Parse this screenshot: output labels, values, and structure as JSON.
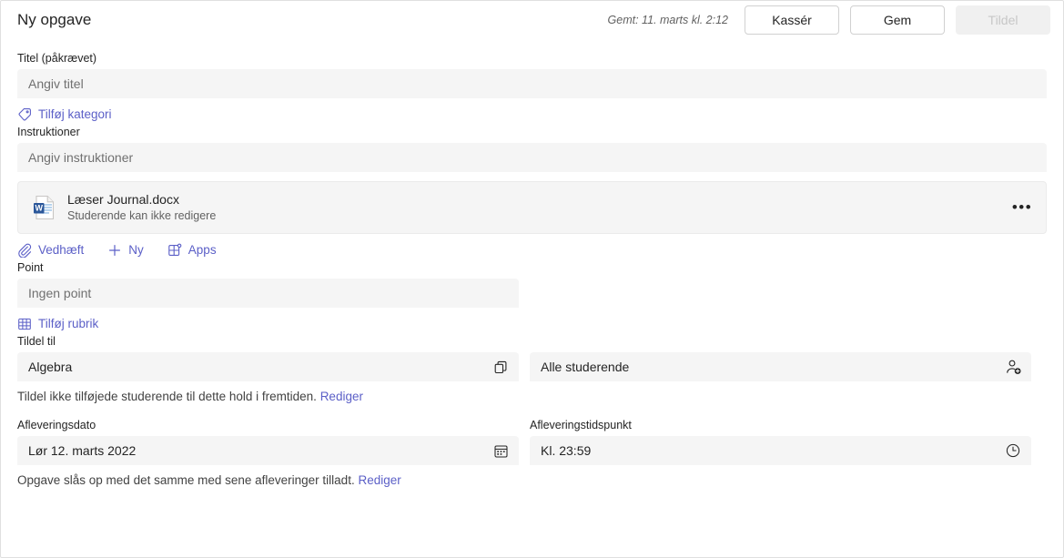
{
  "header": {
    "title": "Ny opgave",
    "saved_text": "Gemt: 11. marts kl. 2:12",
    "discard_label": "Kassér",
    "save_label": "Gem",
    "assign_label": "Tildel"
  },
  "title_field": {
    "label": "Titel (påkrævet)",
    "placeholder": "Angiv titel",
    "value": ""
  },
  "category_link": {
    "label": "Tilføj kategori",
    "icon": "tag-icon"
  },
  "instructions_field": {
    "label": "Instruktioner",
    "placeholder": "Angiv instruktioner",
    "value": ""
  },
  "attachment": {
    "icon": "word-doc-icon",
    "name": "Læser Journal.docx",
    "subtitle": "Studerende kan ikke redigere",
    "more_label": "•••"
  },
  "attach_actions": [
    {
      "label": "Vedhæft",
      "icon": "paperclip-icon"
    },
    {
      "label": "Ny",
      "icon": "plus-icon"
    },
    {
      "label": "Apps",
      "icon": "apps-grid-icon"
    }
  ],
  "points_field": {
    "label": "Point",
    "placeholder": "Ingen point",
    "value": ""
  },
  "rubric_link": {
    "label": "Tilføj rubrik",
    "icon": "grid-table-icon"
  },
  "assign_to": {
    "label": "Tildel til",
    "class_value": "Algebra",
    "class_icon": "copy-stack-icon",
    "students_value": "Alle studerende",
    "students_icon": "person-add-icon",
    "helper_text": "Tildel ikke tilføjede studerende til dette hold i fremtiden.",
    "helper_link": "Rediger"
  },
  "due": {
    "date_label": "Afleveringsdato",
    "date_value": "Lør 12. marts 2022",
    "date_icon": "calendar-icon",
    "time_label": "Afleveringstidspunkt",
    "time_value": "Kl. 23:59",
    "time_icon": "clock-icon",
    "helper_text": "Opgave slås op med det samme med sene afleveringer tilladt.",
    "helper_link": "Rediger"
  },
  "colors": {
    "accent": "#5b5fc7",
    "input_bg": "#f5f5f5",
    "text": "#242424",
    "muted_text": "#616161",
    "disabled_text": "#c7c7c7"
  }
}
